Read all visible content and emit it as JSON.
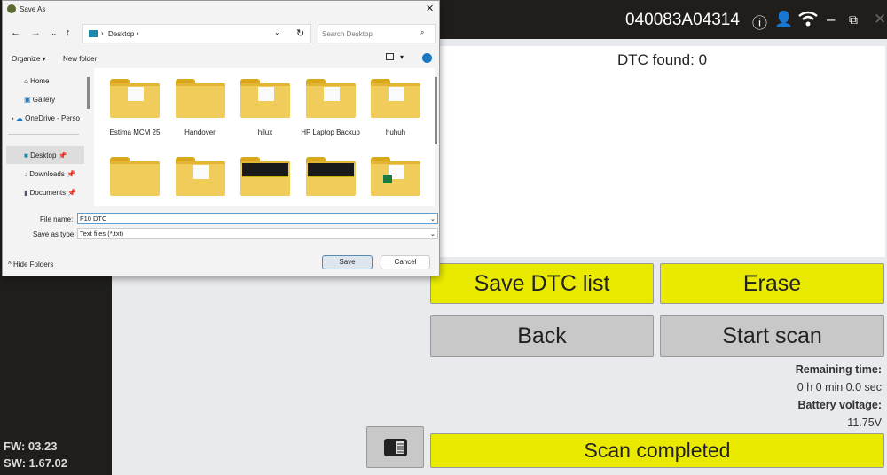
{
  "app": {
    "serial": "040083A04314",
    "fw": "FW: 03.23",
    "sw": "SW: 1.67.02",
    "icons": [
      "info-icon",
      "user-icon",
      "wifi-icon",
      "minimize-icon",
      "restore-icon",
      "close-icon"
    ]
  },
  "main": {
    "dtc_found": "DTC found: 0",
    "save_dtc": "Save DTC list",
    "erase": "Erase",
    "back": "Back",
    "start_scan": "Start scan",
    "remaining_label": "Remaining time:",
    "remaining_value": "0 h 0 min 0.0 sec",
    "battery_label": "Battery voltage:",
    "battery_value": "11.75V",
    "status": "Scan completed",
    "accent": "#eaea00"
  },
  "dialog": {
    "title": "Save As",
    "breadcrumb": "Desktop",
    "search_placeholder": "Search Desktop",
    "organize": "Organize ▾",
    "new_folder": "New folder",
    "nav": [
      {
        "label": "Home",
        "icon": "home-icon"
      },
      {
        "label": "Gallery",
        "icon": "gallery-icon"
      },
      {
        "label": "OneDrive - Perso",
        "icon": "cloud-icon"
      },
      {
        "label": "Desktop",
        "icon": "desktop-icon"
      },
      {
        "label": "Downloads",
        "icon": "download-icon"
      },
      {
        "label": "Documents",
        "icon": "documents-icon"
      }
    ],
    "folders": [
      {
        "name": "Estima MCM 25"
      },
      {
        "name": "Handover"
      },
      {
        "name": "hilux"
      },
      {
        "name": "HP Laptop Backup"
      },
      {
        "name": "huhuh"
      },
      {
        "name": ""
      },
      {
        "name": ""
      },
      {
        "name": ""
      },
      {
        "name": ""
      },
      {
        "name": ""
      }
    ],
    "file_name_label": "File name:",
    "file_name": "F10 DTC",
    "type_label": "Save as type:",
    "type_value": "Text files (*.txt)",
    "hide_folders": "Hide Folders",
    "save": "Save",
    "cancel": "Cancel"
  }
}
